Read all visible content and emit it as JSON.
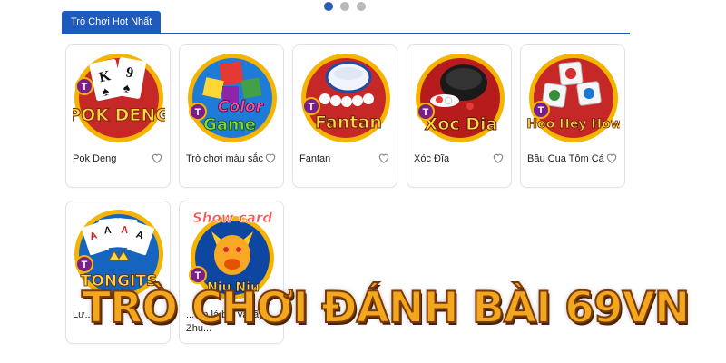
{
  "carousel": {
    "dots": 3,
    "active": 0
  },
  "section": {
    "title": "Trò Chơi Hot Nhất"
  },
  "games": [
    {
      "name": "Pok Deng",
      "art": "POK DENG",
      "badge": "T"
    },
    {
      "name": "Trò chơi màu sắc",
      "art": "Color Game",
      "badge": "T"
    },
    {
      "name": "Fantan",
      "art": "Fantan",
      "badge": "T"
    },
    {
      "name": "Xóc Đĩa",
      "art": "Xoc Dia",
      "badge": "T"
    },
    {
      "name": "Bầu Cua Tôm Cá",
      "art": "Hoo Hey How",
      "badge": "T"
    },
    {
      "name": "Lư...",
      "art": "TONGITS",
      "badge": "T"
    },
    {
      "name": "...em lá bài và lấy Zhu...",
      "art": "Show card",
      "art2": "Niu Niu",
      "badge": "T"
    }
  ],
  "overlay": {
    "headline": "TRÒ CHƠI ĐÁNH BÀI 69VN"
  },
  "colors": {
    "accent": "#1f5bbd",
    "headline": "#f2a71d",
    "badge": "#7a1e8c",
    "ring": "#f4b400"
  }
}
